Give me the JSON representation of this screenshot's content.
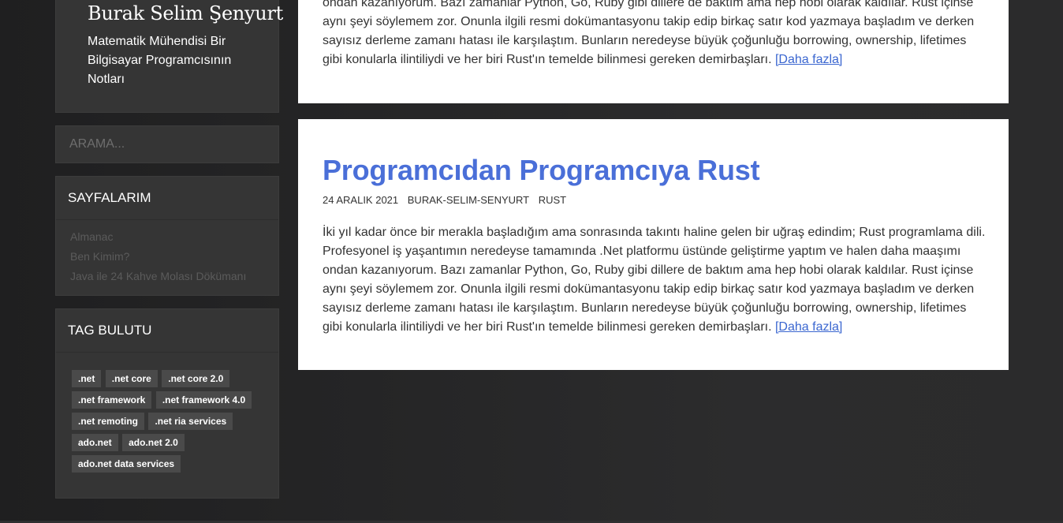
{
  "site": {
    "title": "Burak Selim Şenyurt",
    "description": "Matematik Mühendisi Bir Bilgisayar Programcısının Notları"
  },
  "search": {
    "placeholder": "ARAMA..."
  },
  "pages_widget": {
    "title": "SAYFALARIM",
    "items": [
      "Almanac",
      "Ben Kimim?",
      "Java ile 24 Kahve Molası Dökümanı"
    ]
  },
  "tags_widget": {
    "title": "TAG BULUTU",
    "tags": [
      ".net",
      ".net core",
      ".net core 2.0",
      ".net framework",
      ".net framework 4.0",
      ".net remoting",
      ".net ria services",
      "ado.net",
      "ado.net 2.0",
      "ado.net data services"
    ]
  },
  "posts": [
    {
      "excerpt_partial": "ondan kazanıyorum. Bazı zamanlar Python, Go, Ruby gibi dillere de baktım ama hep hobi olarak kaldılar. Rust içinse aynı şeyi söylemem zor. Onunla ilgili resmi dokümantasyonu takip edip birkaç satır kod yazmaya başladım ve derken sayısız derleme zamanı hatası ile karşılaştım. Bunların neredeyse büyük çoğunluğu borrowing, ownership, lifetimes gibi konularla ilintiliydi ve her biri Rust'ın temelde bilinmesi gereken demirbaşları.",
      "more_label": "[Daha fazla]"
    },
    {
      "title": "Programcıdan Programcıya Rust",
      "date": "24 ARALIK 2021",
      "author": "BURAK-SELIM-SENYURT",
      "category": "RUST",
      "excerpt": "İki yıl kadar önce bir merakla başladığım ama sonrasında takıntı haline gelen bir uğraş edindim; Rust programlama dili. Profesyonel iş yaşantımın neredeyse tamamında .Net platformu üstünde geliştirme yaptım ve halen daha maaşımı ondan kazanıyorum. Bazı zamanlar Python, Go, Ruby gibi dillere de baktım ama hep hobi olarak kaldılar. Rust içinse aynı şeyi söylemem zor. Onunla ilgili resmi dokümantasyonu takip edip birkaç satır kod yazmaya başladım ve derken sayısız derleme zamanı hatası ile karşılaştım. Bunların neredeyse büyük çoğunluğu borrowing, ownership, lifetimes gibi konularla ilintiliydi ve her biri Rust'ın temelde bilinmesi gereken demirbaşları.",
      "more_label": "[Daha fazla]"
    }
  ]
}
